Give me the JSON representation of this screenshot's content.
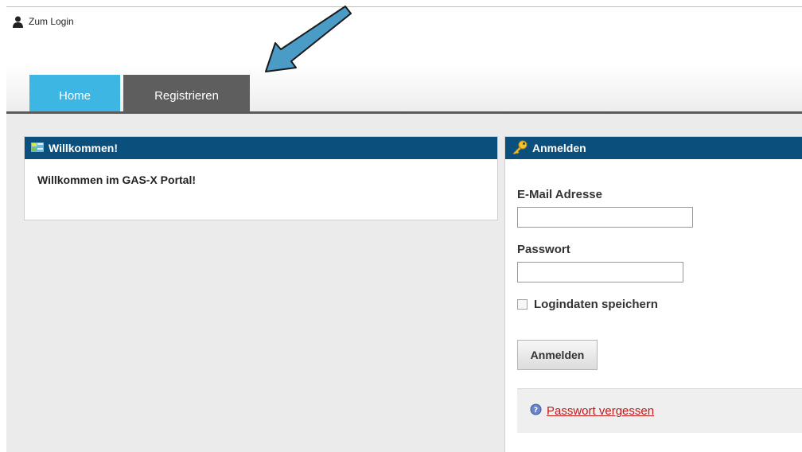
{
  "header": {
    "login_link": "Zum Login",
    "tabs": [
      {
        "label": "Home",
        "color": "#3db6e4"
      },
      {
        "label": "Registrieren",
        "color": "#5e5e5e"
      }
    ]
  },
  "welcome_panel": {
    "title": "Willkommen!",
    "text": "Willkommen im GAS-X Portal!",
    "icon": "welcome-icon"
  },
  "login_panel": {
    "title": "Anmelden",
    "icon": "key-icon",
    "email_label": "E-Mail Adresse",
    "email_value": "",
    "password_label": "Passwort",
    "password_value": "",
    "remember_label": "Logindaten speichern",
    "remember_checked": false,
    "submit_label": "Anmelden",
    "forgot_label": "Passwort vergessen",
    "forgot_icon": "help-icon"
  },
  "colors": {
    "panel_header": "#0b4f7c",
    "link": "#c21a1a",
    "arrow": "#4a9cc7"
  }
}
